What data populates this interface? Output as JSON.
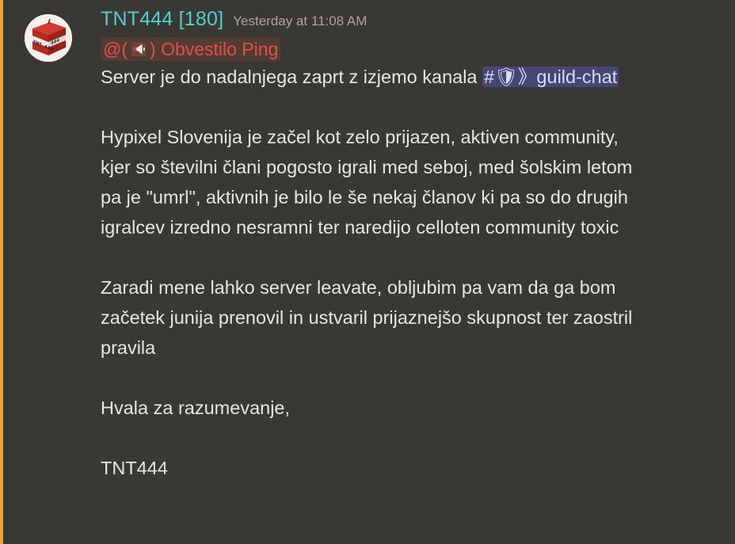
{
  "message": {
    "username": "TNT444 [180]",
    "timestamp": "Yesterday at 11:08 AM",
    "role_mention": {
      "prefix": "@(",
      "icon": "megaphone-icon",
      "suffix": ") Obvestilo Ping"
    },
    "line1_text": "Server je do nadalnjega zaprt z izjemo kanala ",
    "channel_mention": "#🛡》guild-chat",
    "paragraph2": "Hypixel Slovenija je začel kot zelo prijazen, aktiven community, kjer so številni člani pogosto igrali med seboj, med šolskim letom pa je \"umrl\", aktivnih je bilo le še nekaj članov ki pa so do drugih igralcev izredno nesramni ter naredijo celloten community toxic",
    "paragraph3": "Zaradi mene lahko server leavate, obljubim pa vam da ga bom začetek junija prenovil in ustvaril prijaznejšo skupnost ter zaostril pravila",
    "paragraph4": "Hvala za razumevanje,",
    "signature": "TNT444"
  },
  "colors": {
    "mention_bar": "#f0a822",
    "username": "#4fd0d8",
    "role_mention": "#e84c45",
    "channel_mention_bg": "#4b4f8a",
    "text": "#e8e6e1",
    "timestamp": "#a9a69d"
  },
  "avatar": {
    "icon": "tnt-block-avatar",
    "label_text": "TNT 444"
  }
}
